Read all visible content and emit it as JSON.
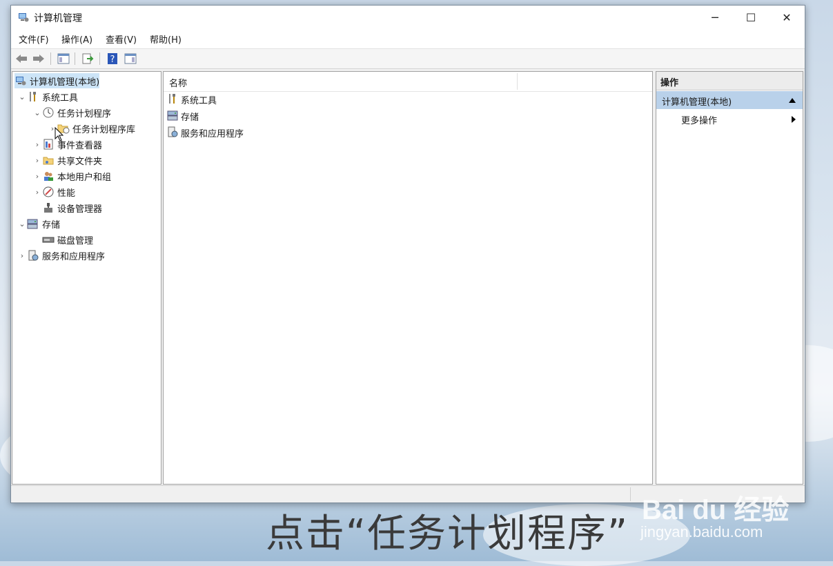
{
  "window": {
    "title": "计算机管理",
    "controls": {
      "minimize": "─",
      "maximize": "☐",
      "close": "✕"
    }
  },
  "menu": [
    "文件(F)",
    "操作(A)",
    "查看(V)",
    "帮助(H)"
  ],
  "toolbar": {
    "buttons": [
      "back-icon",
      "forward-icon",
      "show-tree-icon",
      "export-list-icon",
      "help-icon",
      "show-action-pane-icon"
    ]
  },
  "tree": {
    "root": "计算机管理(本地)",
    "system_tools": "系统工具",
    "task_scheduler": "任务计划程序",
    "task_scheduler_library": "任务计划程序库",
    "event_viewer": "事件查看器",
    "shared_folders": "共享文件夹",
    "local_users": "本地用户和组",
    "performance": "性能",
    "device_manager": "设备管理器",
    "storage": "存储",
    "disk_management": "磁盘管理",
    "services_apps": "服务和应用程序"
  },
  "list": {
    "column_name": "名称",
    "items": [
      "系统工具",
      "存储",
      "服务和应用程序"
    ]
  },
  "actions": {
    "header": "操作",
    "section": "计算机管理(本地)",
    "more": "更多操作"
  },
  "overlay": {
    "caption": "点击“任务计划程序”",
    "watermark": "Bai du 经验",
    "watermark_url": "jingyan.baidu.com"
  },
  "colors": {
    "selection": "#cce4f7",
    "action_section": "#b9d1ea"
  }
}
